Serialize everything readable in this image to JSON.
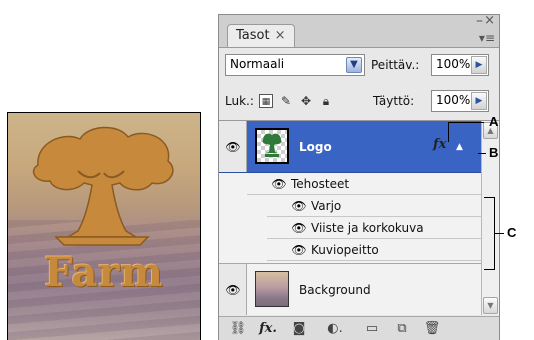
{
  "panel": {
    "tab_label": "Tasot",
    "tab_close": "×",
    "window_min": "–",
    "window_close": "×",
    "menu_glyph": "▾≡",
    "blend_mode": "Normaali",
    "opacity_label": "Peittäv.:",
    "opacity_value": "100%",
    "lock_label": "Luk.:",
    "fill_label": "Täyttö:",
    "fill_value": "100%"
  },
  "layers": [
    {
      "name": "Logo",
      "selected": true,
      "has_fx": true,
      "fx_glyph": "fx"
    },
    {
      "name": "Background",
      "selected": false
    }
  ],
  "effects": {
    "group_label": "Tehosteet",
    "items": [
      "Varjo",
      "Viiste ja korkokuva",
      "Kuviopeitto"
    ]
  },
  "preview": {
    "text": "Farm"
  },
  "callouts": {
    "a": "A",
    "b": "B",
    "c": "C"
  },
  "bottom_bar": {
    "fx_label": "fx."
  },
  "colors": {
    "selected_layer": "#3a64c3",
    "panel_bg": "#e8e8e8",
    "farm_text": "#c58a3d"
  }
}
